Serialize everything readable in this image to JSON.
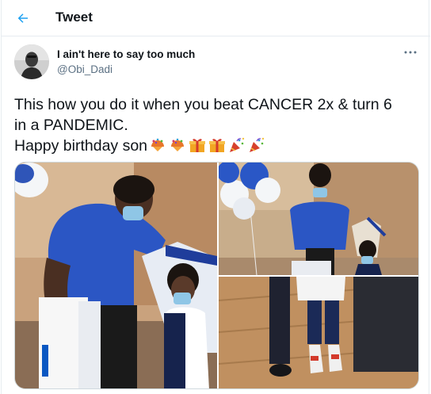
{
  "header": {
    "title": "Tweet",
    "back_icon": "arrow-left-icon"
  },
  "author": {
    "display_name": "I ain't here to say too much",
    "handle": "@Obi_Dadi"
  },
  "tweet": {
    "lines": [
      "This how you do it when you beat CANCER 2x & turn 6",
      "in a PANDEMIC.",
      "Happy birthday son"
    ],
    "emojis": [
      "confetti-ball-icon",
      "confetti-ball-icon",
      "wrapped-gift-icon",
      "wrapped-gift-icon",
      "party-popper-icon",
      "party-popper-icon"
    ]
  },
  "media": {
    "photos": [
      "photo-1",
      "photo-2",
      "photo-3"
    ]
  },
  "colors": {
    "accent": "#1da1f2",
    "text": "#0f1419",
    "secondary": "#5b7083",
    "border": "#e6ecf0"
  }
}
